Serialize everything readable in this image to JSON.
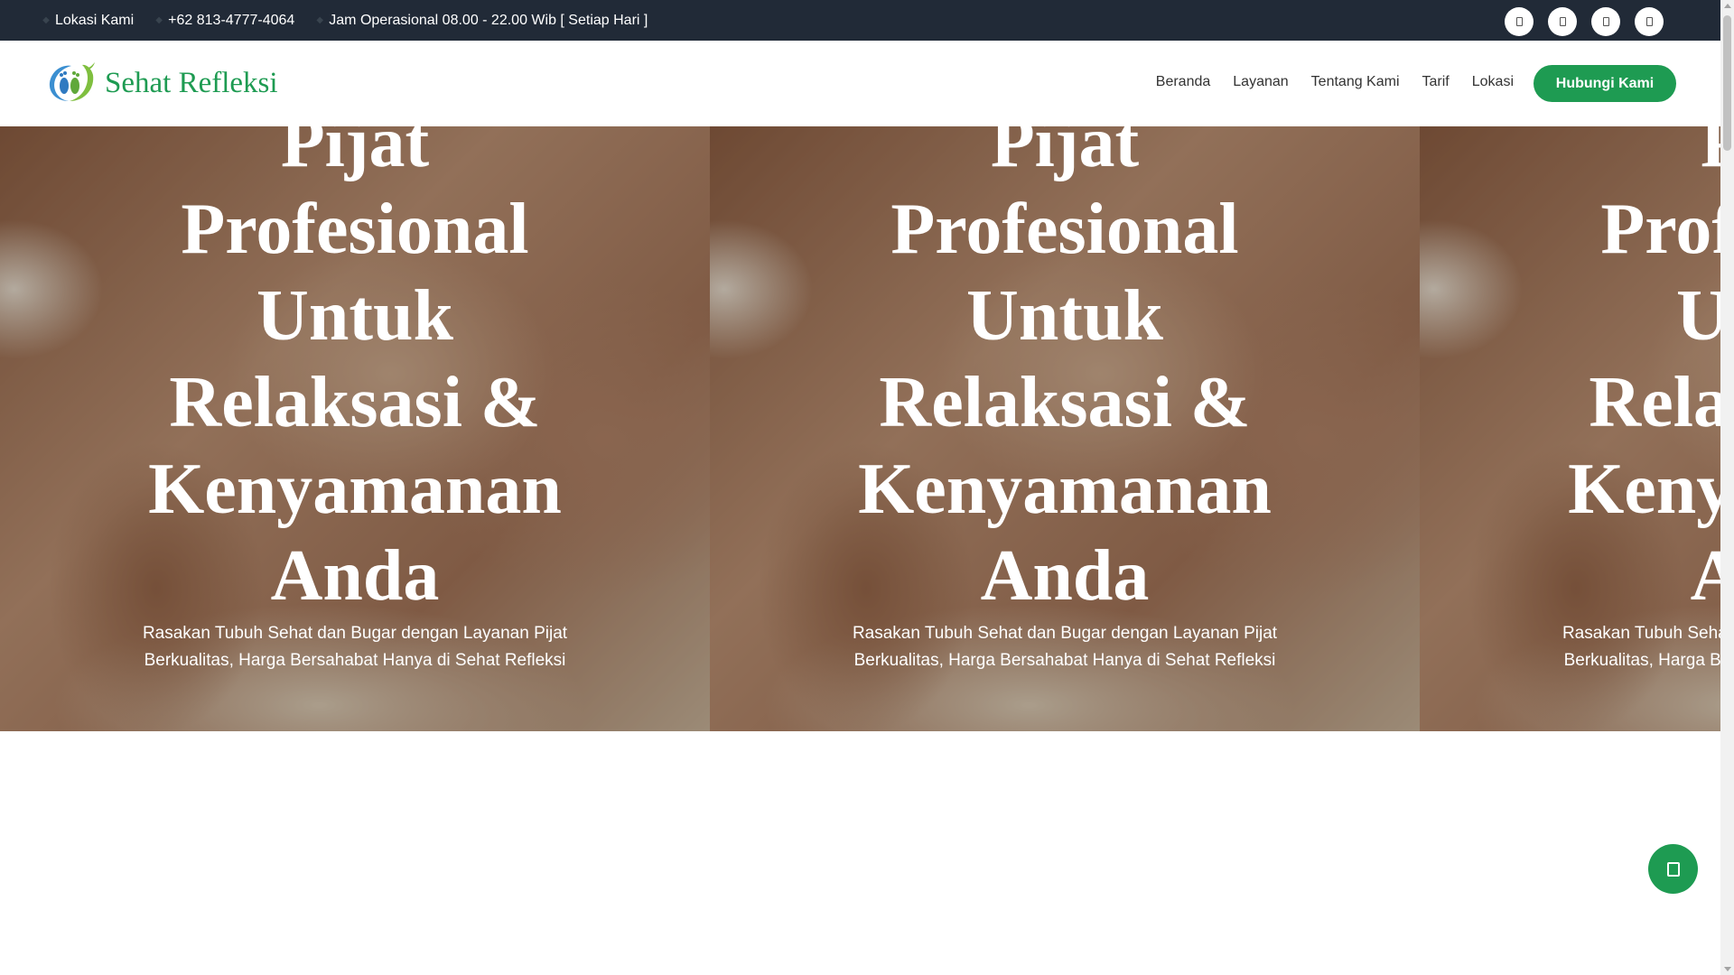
{
  "topbar": {
    "location": "Lokasi Kami",
    "phone": "+62 813-4777-4064",
    "hours": "Jam Operasional 08.00 - 22.00 Wib [ Setiap Hari ]",
    "socials": [
      "facebook-icon",
      "instagram-icon",
      "youtube-icon",
      "tiktok-icon"
    ]
  },
  "brand": {
    "name": "Sehat Refleksi",
    "accent_color": "#1e9b52",
    "topbar_color": "#212a37"
  },
  "nav": {
    "items": [
      "Beranda",
      "Layanan",
      "Tentang Kami",
      "Tarif",
      "Lokasi"
    ],
    "cta": "Hubungi Kami"
  },
  "hero": {
    "title": "Pijat Profesional Untuk Relaksasi & Kenyamanan Anda",
    "subtitle": "Rasakan Tubuh Sehat dan Bugar dengan Layanan Pijat Berkualitas, Harga Bersahabat Hanya di Sehat Refleksi"
  },
  "floating": {
    "icon": "whatsapp-icon"
  }
}
